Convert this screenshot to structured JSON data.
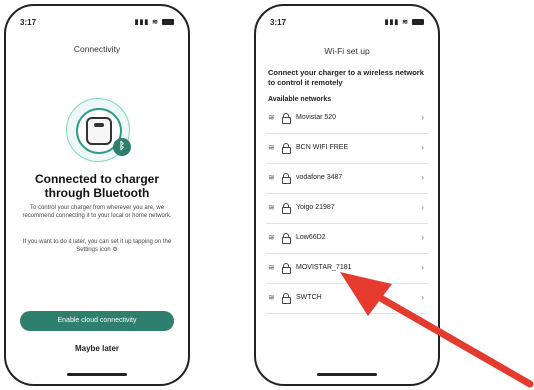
{
  "phone1": {
    "status_time": "3:17",
    "title": "Connectivity",
    "heading": "Connected to charger through Bluetooth",
    "paragraph1": "To control your charger from wherever you are, we recommend connecting it to your local or home network.",
    "paragraph2": "If you want to do it later, you can set it up tapping on the Settings icon",
    "settings_glyph": "⚙",
    "bluetooth_glyph": "ᛒ",
    "primary_button": "Enable cloud connectivity",
    "secondary_button": "Maybe later"
  },
  "phone2": {
    "status_time": "3:17",
    "title": "Wi-Fi set up",
    "intro": "Connect your charger to a wireless network to control it remotely",
    "section_label": "Available networks",
    "networks": [
      {
        "name": "Movistar 520"
      },
      {
        "name": "BCN WIFI FREE"
      },
      {
        "name": "vodafone 3487"
      },
      {
        "name": "Yoigo 21987"
      },
      {
        "name": "Low66D2"
      },
      {
        "name": "MOVISTAR_7181"
      },
      {
        "name": "SWTCH"
      }
    ]
  },
  "colors": {
    "accent": "#2f7f6f",
    "arrow": "#e53b2e"
  },
  "icons": {
    "wifi": "wifi-icon",
    "lock": "lock-icon",
    "chevron": "chevron-right-icon",
    "bluetooth": "bluetooth-icon",
    "settings": "gear-icon"
  }
}
